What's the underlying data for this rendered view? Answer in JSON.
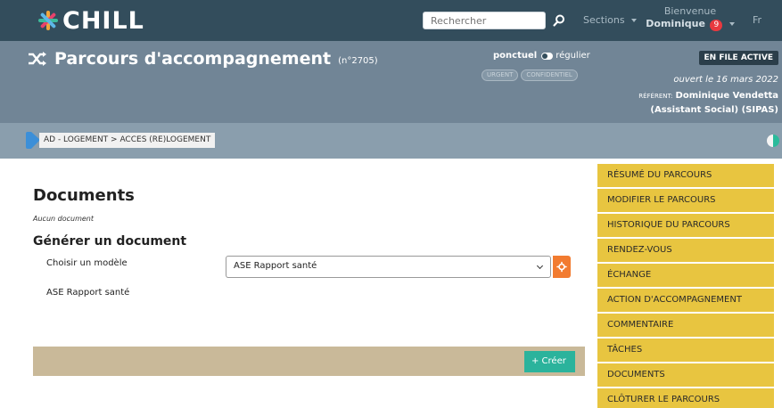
{
  "nav": {
    "logo_text": "CHILL",
    "search_placeholder": "Rechercher",
    "sections_label": "Sections",
    "greeting": "Bienvenue",
    "user_name": "Dominique",
    "notification_count": "9",
    "language": "Fr"
  },
  "banner": {
    "title": "Parcours d'accompagnement",
    "number": "(n°2705)",
    "toggle_on": "ponctuel",
    "toggle_off": "régulier",
    "tag_urgent": "URGENT",
    "tag_confidential": "CONFIDENTIEL",
    "status": "EN FILE ACTIVE",
    "opened": "ouvert le 16 mars 2022",
    "referent_label": "RÉFÉRENT:",
    "referent_name": "Dominique Vendetta (Assistant Social) (SIPAS)"
  },
  "issue": {
    "label": "AD - LOGEMENT > ACCES (RE)LOGEMENT"
  },
  "main": {
    "heading": "Documents",
    "empty_text": "Aucun document",
    "generate_heading": "Générer un document",
    "model_label": "Choisir un modèle",
    "model_selected": "ASE Rapport santé",
    "model_option_text": "ASE Rapport santé",
    "create_label": "+ Créer"
  },
  "menu": {
    "items": [
      "Résumé du parcours",
      "Modifier le parcours",
      "Historique du parcours",
      "Rendez-vous",
      "Échange",
      "Action d'accompagnement",
      "Commentaire",
      "Tâches",
      "Documents",
      "Clôturer le parcours"
    ]
  },
  "colors": {
    "navbar": "#334d5c",
    "banner": "#718596",
    "menu": "#e8c540",
    "create": "#2bb39c",
    "gear": "#f27b30"
  }
}
